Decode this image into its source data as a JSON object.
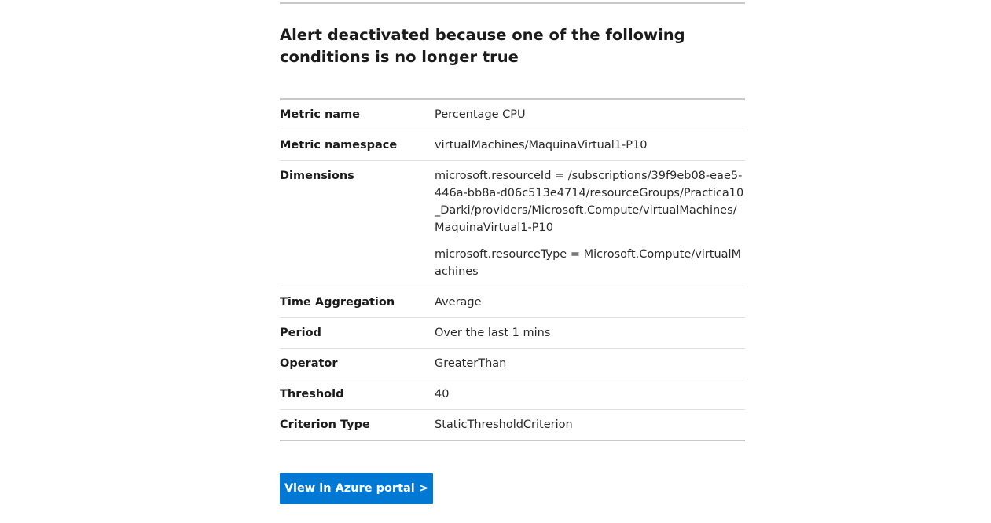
{
  "title": "Alert deactivated because one of the following conditions is no longer true",
  "rows": [
    {
      "label": "Metric name",
      "value": "Percentage CPU"
    },
    {
      "label": "Metric namespace",
      "value": "virtualMachines/MaquinaVirtual1-P10"
    },
    {
      "label": "Dimensions",
      "value_1": "microsoft.resourceId = /subscriptions/39f9eb08-eae5-446a-bb8a-d06c513e4714/resourceGroups/Practica10_Darki/providers/Microsoft.Compute/virtualMachines/MaquinaVirtual1-P10",
      "value_2": "microsoft.resourceType = Microsoft.Compute/virtualMachines"
    },
    {
      "label": "Time Aggregation",
      "value": "Average"
    },
    {
      "label": "Period",
      "value": "Over the last 1 mins"
    },
    {
      "label": "Operator",
      "value": "GreaterThan"
    },
    {
      "label": "Threshold",
      "value": "40"
    },
    {
      "label": "Criterion Type",
      "value": "StaticThresholdCriterion"
    }
  ],
  "button": {
    "label": "View in Azure portal >"
  },
  "colors": {
    "accent": "#0078d4",
    "rule": "#c8c8c8",
    "row_divider": "#e1e1e1"
  }
}
